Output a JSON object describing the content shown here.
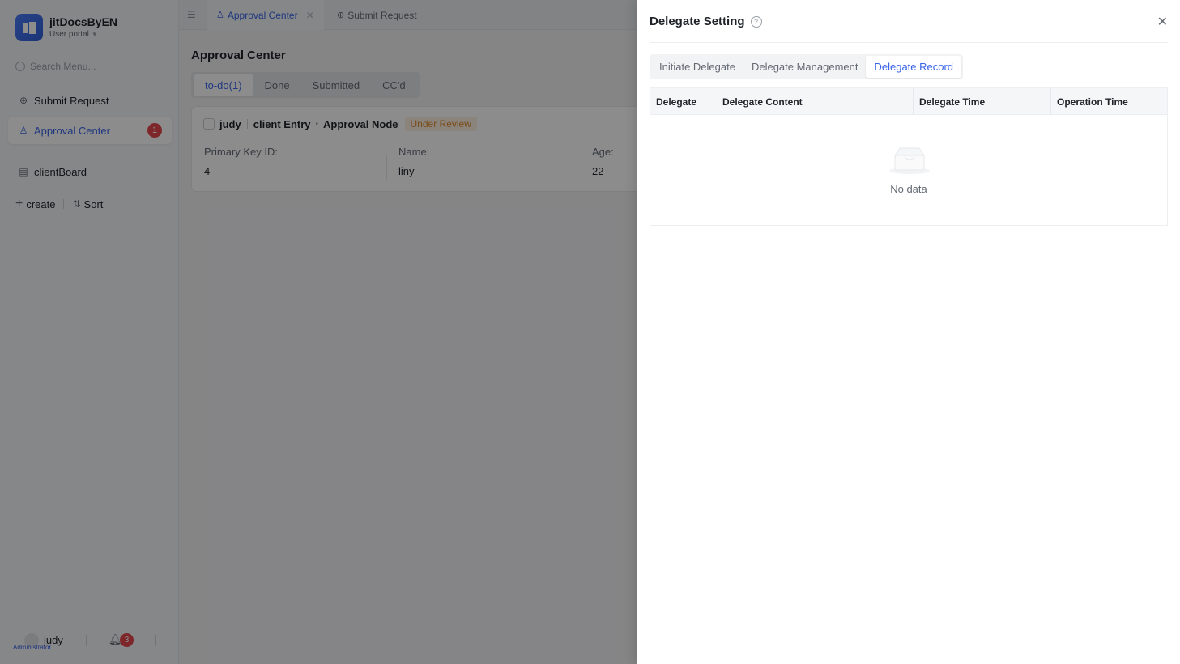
{
  "brand": {
    "title": "jitDocsByEN",
    "subtitle": "User portal"
  },
  "sidebar": {
    "search_placeholder": "Search Menu...",
    "items": [
      {
        "label": "Submit Request"
      },
      {
        "label": "Approval Center",
        "badge": "1"
      },
      {
        "label": "clientBoard"
      }
    ],
    "actions": {
      "create": "create",
      "sort": "Sort"
    },
    "footer": {
      "user_name": "judy",
      "user_role": "Administrator",
      "notifications": "3"
    }
  },
  "tabs": [
    {
      "label": "Approval Center"
    },
    {
      "label": "Submit Request"
    }
  ],
  "main": {
    "title": "Approval Center",
    "segments": [
      "to-do(1)",
      "Done",
      "Submitted",
      "CC'd"
    ],
    "card": {
      "user": "judy",
      "entry": "client Entry",
      "node": "Approval Node",
      "status": "Under Review",
      "fields": [
        {
          "label": "Primary Key ID:",
          "value": "4"
        },
        {
          "label": "Name:",
          "value": "liny"
        },
        {
          "label": "Age:",
          "value": "22"
        }
      ]
    }
  },
  "drawer": {
    "title": "Delegate Setting",
    "tabs": [
      "Initiate Delegate",
      "Delegate Management",
      "Delegate Record"
    ],
    "active_tab": "Delegate Record",
    "columns": [
      "Delegate",
      "Delegate Content",
      "Delegate Time",
      "Operation Time"
    ],
    "empty_text": "No data"
  },
  "colors": {
    "accent": "#3a64e8",
    "badge": "#e5484d",
    "warning": "#e08a2d"
  }
}
